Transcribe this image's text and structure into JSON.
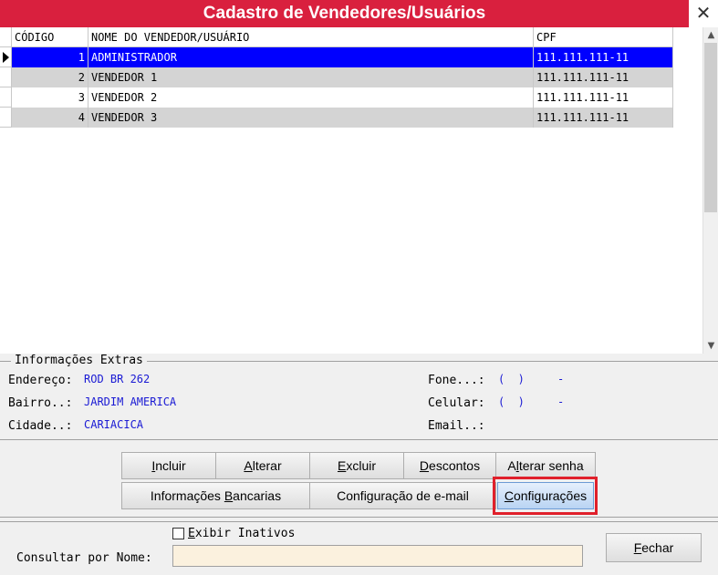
{
  "window": {
    "title": "Cadastro de Vendedores/Usuários",
    "close_glyph": "✕"
  },
  "grid": {
    "columns": [
      "CÓDIGO",
      "NOME DO VENDEDOR/USUÁRIO",
      "CPF"
    ],
    "rows": [
      {
        "code": "1",
        "name": "ADMINISTRADOR",
        "cpf": "111.111.111-11"
      },
      {
        "code": "2",
        "name": "VENDEDOR 1",
        "cpf": "111.111.111-11"
      },
      {
        "code": "3",
        "name": "VENDEDOR 2",
        "cpf": "111.111.111-11"
      },
      {
        "code": "4",
        "name": "VENDEDOR 3",
        "cpf": "111.111.111-11"
      }
    ],
    "selected_index": 0
  },
  "extras": {
    "legend": "Informações Extras",
    "endereco_label": "Endereço:",
    "endereco_value": "ROD BR 262",
    "bairro_label": "Bairro..:",
    "bairro_value": "JARDIM AMERICA",
    "cidade_label": "Cidade..:",
    "cidade_value": "CARIACICA",
    "fone_label": "Fone...:",
    "fone_value": "(  )     -",
    "celular_label": "Celular:",
    "celular_value": "(  )     -",
    "email_label": "Email..:"
  },
  "buttons": {
    "incluir": {
      "first": "I",
      "rest": "ncluir"
    },
    "alterar": {
      "first": "A",
      "rest": "lterar"
    },
    "excluir": {
      "first": "E",
      "rest": "xcluir"
    },
    "descontos": {
      "first": "D",
      "rest": "escontos"
    },
    "alterar_senha": {
      "before": "A",
      "u": "l",
      "after": "terar senha"
    },
    "info_bancarias": {
      "before": "Informações ",
      "u": "B",
      "after": "ancarias"
    },
    "config_email": "Configuração de e-mail",
    "configuracoes": {
      "first": "C",
      "rest": "onfigurações"
    }
  },
  "bottom": {
    "exibir_inativos": {
      "first": "E",
      "rest": "xibir Inativos"
    },
    "consultar_label": "Consultar por Nome:",
    "consultar_value": "",
    "fechar": {
      "first": "F",
      "rest": "echar"
    }
  }
}
